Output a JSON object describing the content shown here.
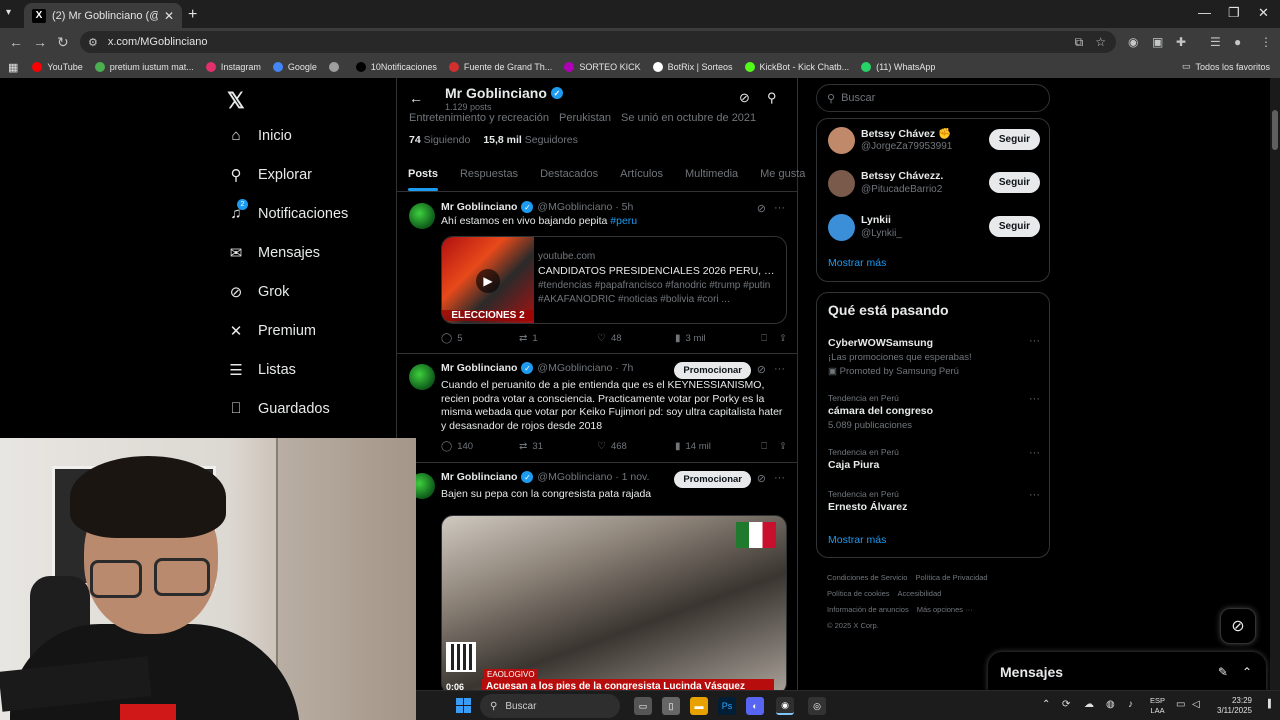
{
  "browser": {
    "tab_title": "(2) Mr Goblinciano (@MGoblinc...",
    "url": "x.com/MGoblinciano",
    "bookmarks": [
      {
        "label": "YouTube",
        "color": "#ff0000"
      },
      {
        "label": "pretium iustum mat...",
        "color": "#4caf50"
      },
      {
        "label": "Instagram",
        "color": "#e1306c"
      },
      {
        "label": "Google",
        "color": "#4285f4"
      },
      {
        "label": "",
        "color": "#9e9e9e"
      },
      {
        "label": "10Notificaciones",
        "color": "#000000"
      },
      {
        "label": "Fuente de Grand Th...",
        "color": "#d32f2f"
      },
      {
        "label": "SORTEO KICK",
        "color": "#b000b5"
      },
      {
        "label": "BotRix | Sorteos",
        "color": "#ffffff"
      },
      {
        "label": "KickBot - Kick Chatb...",
        "color": "#53fc18"
      },
      {
        "label": "(11) WhatsApp",
        "color": "#25d366"
      }
    ],
    "all_bookmarks": "Todos los favoritos"
  },
  "nav": {
    "items": [
      {
        "label": "Inicio",
        "icon": "home-icon",
        "glyph": "⌂"
      },
      {
        "label": "Explorar",
        "icon": "search-icon",
        "glyph": "⚲"
      },
      {
        "label": "Notificaciones",
        "icon": "bell-icon",
        "glyph": "♫"
      },
      {
        "label": "Mensajes",
        "icon": "mail-icon",
        "glyph": "✉"
      },
      {
        "label": "Grok",
        "icon": "grok-icon",
        "glyph": "⊘"
      },
      {
        "label": "Premium",
        "icon": "x-icon",
        "glyph": "✕"
      },
      {
        "label": "Listas",
        "icon": "list-icon",
        "glyph": "☰"
      },
      {
        "label": "Guardados",
        "icon": "bookmark-icon",
        "glyph": "⎕"
      }
    ],
    "notif_badge": "2"
  },
  "profile": {
    "name": "Mr Goblinciano",
    "posts_count": "1.129 posts",
    "category": "Entretenimiento y recreación",
    "location": "Perukistan",
    "joined": "Se unió en octubre de 2021",
    "following_count": "74",
    "following_label": "Siguiendo",
    "followers_count": "15,8 mil",
    "followers_label": "Seguidores",
    "tabs": [
      "Posts",
      "Respuestas",
      "Destacados",
      "Artículos",
      "Multimedia",
      "Me gusta"
    ]
  },
  "posts": [
    {
      "name": "Mr Goblinciano",
      "handle": "@MGoblinciano · 5h",
      "text": "Ahí estamos en vivo bajando pepita ",
      "hashtag": "#peru",
      "card": {
        "domain": "youtube.com",
        "title": "CANDIDATOS PRESIDENCIALES 2026 PERU, CODI...",
        "desc": "#tendencias #papafrancisco #fanodric #trump #putin #AKAFANODRIC #noticias #bolivia #cori ...",
        "thumb_text": "ELECCIONES 2"
      },
      "replies": "5",
      "reposts": "1",
      "likes": "48",
      "views": "3 mil"
    },
    {
      "name": "Mr Goblinciano",
      "handle": "@MGoblinciano · 7h",
      "promo": "Promocionar",
      "text": "Cuando el peruanito de a pie entienda que es el KEYNESSIANISMO, recien podra votar a consciencia. Practicamente votar por Porky es la misma webada que votar por Keiko Fujimori pd: soy ultra capitalista hater y desasnador de rojos desde 2018",
      "replies": "140",
      "reposts": "31",
      "likes": "468",
      "views": "14 mil"
    },
    {
      "name": "Mr Goblinciano",
      "handle": "@MGoblinciano · 1 nov.",
      "promo": "Promocionar",
      "text": "Bajen su pepa con la congresista pata rajada",
      "media": {
        "caption": "Acuesan a los pies de la congresista Lucinda Vásquez",
        "tag": "EAOLOGIVO",
        "time": "0:06"
      }
    }
  ],
  "right": {
    "search_placeholder": "Buscar",
    "who_to_follow": [
      {
        "name": "Betssy Chávez ✊",
        "handle": "@JorgeZa79953991",
        "btn": "Seguir",
        "color": "#c08a6a"
      },
      {
        "name": "Betssy Chávezz.",
        "handle": "@PitucadeBarrio2",
        "btn": "Seguir",
        "color": "#7a5a4a"
      },
      {
        "name": "Lynkii",
        "handle": "@Lynkii_",
        "btn": "Seguir",
        "color": "#3a8fd8"
      }
    ],
    "show_more": "Mostrar más",
    "trends_title": "Qué está pasando",
    "trends": [
      {
        "context": "",
        "name": "CyberWOWSamsung",
        "sub": "¡Las promociones que esperabas!",
        "promoted": "Promoted by Samsung Perú"
      },
      {
        "context": "Tendencia en Perú",
        "name": "cámara del congreso",
        "sub": "5.089 publicaciones"
      },
      {
        "context": "Tendencia en Perú",
        "name": "Caja Piura",
        "sub": ""
      },
      {
        "context": "Tendencia en Perú",
        "name": "Ernesto Álvarez",
        "sub": ""
      }
    ],
    "trends_more": "Mostrar más",
    "footer": [
      "Condiciones de Servicio",
      "Política de Privacidad",
      "Política de cookies",
      "Accesibilidad",
      "Información de anuncios",
      "Más opciones ···",
      "© 2025 X Corp."
    ]
  },
  "messages_drawer": "Mensajes",
  "taskbar": {
    "search_placeholder": "Buscar",
    "lang_top": "ESP",
    "lang_bottom": "LAA",
    "time": "23:29",
    "date": "3/11/2025"
  }
}
